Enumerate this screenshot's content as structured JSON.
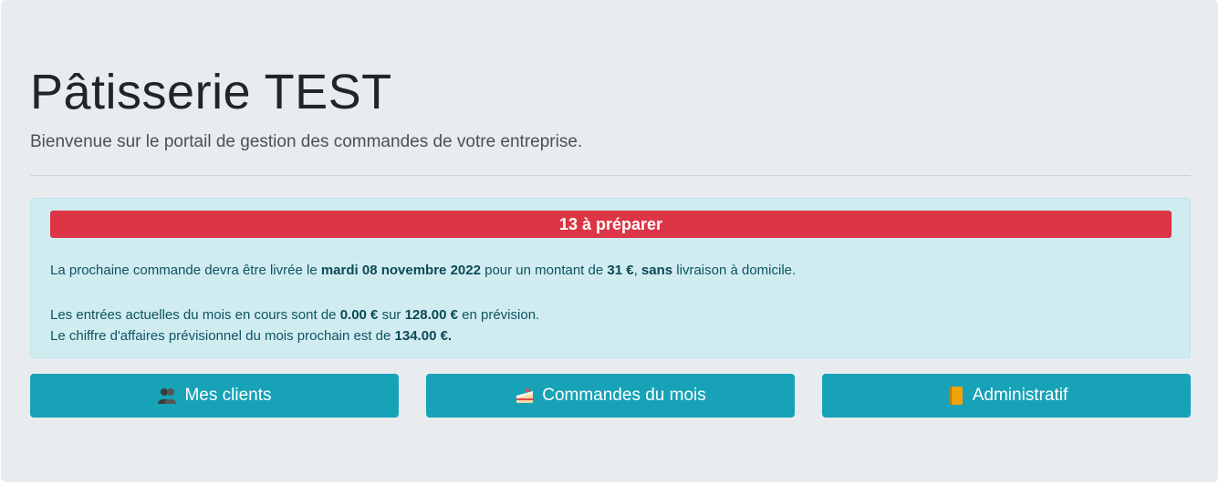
{
  "header": {
    "title": "Pâtisserie TEST",
    "subtitle": "Bienvenue sur le portail de gestion des commandes de votre entreprise."
  },
  "alert": {
    "badge": "13 à préparer",
    "next_order": {
      "prefix": "La prochaine commande devra être livrée le ",
      "date": "mardi 08 novembre 2022",
      "mid": " pour un montant de ",
      "amount": "31 €",
      "sep": ", ",
      "delivery_flag": "sans",
      "suffix": " livraison à domicile."
    },
    "month_income": {
      "prefix": "Les entrées actuelles du mois en cours sont de ",
      "current": "0.00 €",
      "mid": " sur ",
      "forecast": "128.00 €",
      "suffix": " en prévision."
    },
    "next_month": {
      "prefix": "Le chiffre d'affaires prévisionnel du mois prochain est de ",
      "amount": "134.00 €."
    }
  },
  "buttons": [
    {
      "label": "Mes clients",
      "icon": "people-icon"
    },
    {
      "label": "Commandes du mois",
      "icon": "cake-icon"
    },
    {
      "label": "Administratif",
      "icon": "notebook-icon"
    }
  ],
  "colors": {
    "alert_bg": "#d1ecf1",
    "badge_bg": "#dc3545",
    "button_bg": "#17a2b8"
  }
}
